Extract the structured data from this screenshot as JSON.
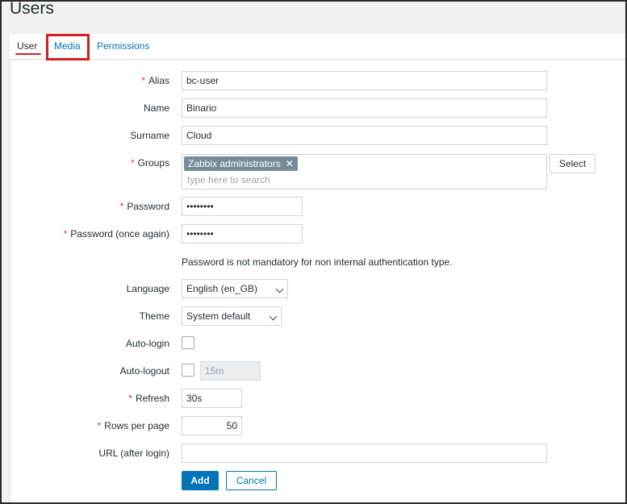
{
  "page": {
    "title": "Users"
  },
  "tabs": [
    {
      "label": "User",
      "active": true
    },
    {
      "label": "Media",
      "active": false
    },
    {
      "label": "Permissions",
      "active": false
    }
  ],
  "form": {
    "alias": {
      "label": "Alias",
      "required": true,
      "value": "bc-user"
    },
    "name": {
      "label": "Name",
      "value": "Binario"
    },
    "surname": {
      "label": "Surname",
      "value": "Cloud"
    },
    "groups": {
      "label": "Groups",
      "required": true,
      "tags": [
        "Zabbix administrators"
      ],
      "placeholder": "type here to search",
      "select_label": "Select"
    },
    "password": {
      "label": "Password",
      "required": true,
      "value": "••••••••"
    },
    "password_again": {
      "label": "Password (once again)",
      "required": true,
      "value": "••••••••"
    },
    "password_hint": "Password is not mandatory for non internal authentication type.",
    "language": {
      "label": "Language",
      "value": "English (en_GB)"
    },
    "theme": {
      "label": "Theme",
      "value": "System default"
    },
    "autologin": {
      "label": "Auto-login",
      "checked": false
    },
    "autologout": {
      "label": "Auto-logout",
      "checked": false,
      "value": "15m"
    },
    "refresh": {
      "label": "Refresh",
      "required": true,
      "value": "30s"
    },
    "rows_per_page": {
      "label": "Rows per page",
      "required": true,
      "value": "50"
    },
    "url": {
      "label": "URL (after login)",
      "value": ""
    },
    "buttons": {
      "add": "Add",
      "cancel": "Cancel"
    }
  },
  "colors": {
    "accent": "#0275b8",
    "required": "#e33734",
    "annotation": "#d21f1f",
    "tag_bg": "#768d99"
  },
  "icons": {
    "tag_remove": "close-icon",
    "dropdown": "chevron-down-icon"
  }
}
